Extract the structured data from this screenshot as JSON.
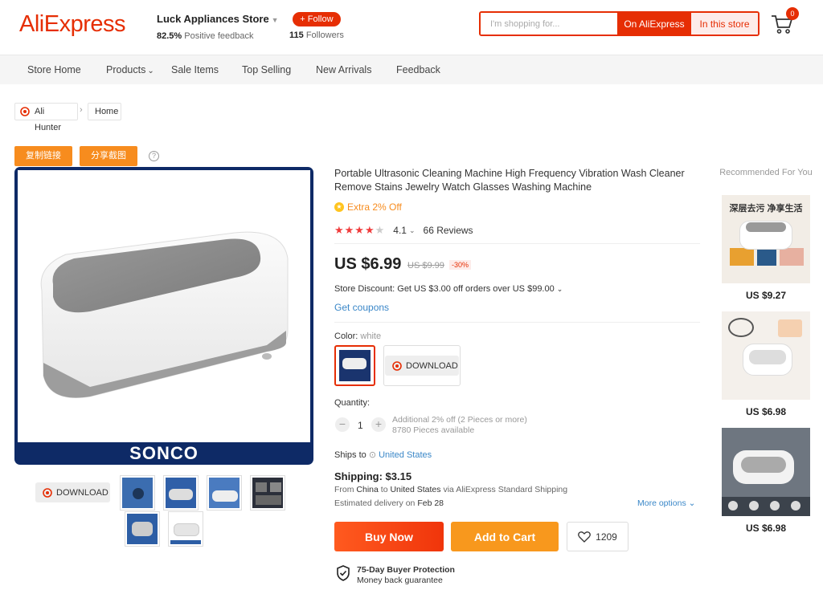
{
  "header": {
    "logo": "AliExpress",
    "store_name": "Luck Appliances Store",
    "feedback_value": "82.5%",
    "feedback_label": "Positive feedback",
    "follow_label": "+ Follow",
    "followers_count": "115",
    "followers_label": "Followers",
    "search_placeholder": "I'm shopping for...",
    "search_on_ali": "On AliExpress",
    "search_in_store": "In this store",
    "cart_count": "0",
    "brand_color": "#e62e04"
  },
  "nav": {
    "items": [
      "Store Home",
      "Products",
      "Sale Items",
      "Top Selling",
      "New Arrivals",
      "Feedback"
    ]
  },
  "breadcrumb": {
    "items": [
      "Ali Hunter",
      "Home"
    ]
  },
  "tools": {
    "copy_link": "复制链接",
    "share_screenshot": "分享截图",
    "help": "?"
  },
  "gallery": {
    "brand": "SONCO",
    "download_label": "DOWNLOAD"
  },
  "product": {
    "title": "Portable Ultrasonic Cleaning Machine High Frequency Vibration Wash Cleaner Remove Stains Jewelry Watch Glasses Washing Machine",
    "extra_off": "Extra 2% Off",
    "rating": "4.1",
    "rating_value": 4.1,
    "reviews": "66 Reviews",
    "price": "US $6.99",
    "old_price": "US $9.99",
    "discount": "-30%",
    "store_discount": "Store Discount: Get US $3.00 off orders over US $99.00",
    "coupons": "Get coupons",
    "color_label": "Color:",
    "color_value": "white",
    "color_download": "DOWNLOAD",
    "quantity_label": "Quantity:",
    "quantity": "1",
    "qty_extra": "Additional 2% off (2 Pieces or more)",
    "qty_available": "8780 Pieces available",
    "ships_to_label": "Ships to",
    "ships_to_value": "United States",
    "shipping": "Shipping: $3.15",
    "ship_from_prefix": "From",
    "ship_from_origin": "China",
    "ship_from_to": "to",
    "ship_from_dest": "United States",
    "ship_from_via": "via AliExpress Standard Shipping",
    "delivery_prefix": "Estimated delivery on",
    "delivery_date": "Feb 28",
    "more_options": "More options",
    "buy_now": "Buy Now",
    "add_to_cart": "Add to Cart",
    "wishlist_count": "1209",
    "protection_title": "75-Day Buyer Protection",
    "protection_sub": "Money back guarantee"
  },
  "recommended": {
    "title": "Recommended For You",
    "items": [
      {
        "price": "US $9.27",
        "banner": "深层去污 净享生活"
      },
      {
        "price": "US $6.98"
      },
      {
        "price": "US $6.98"
      }
    ]
  }
}
